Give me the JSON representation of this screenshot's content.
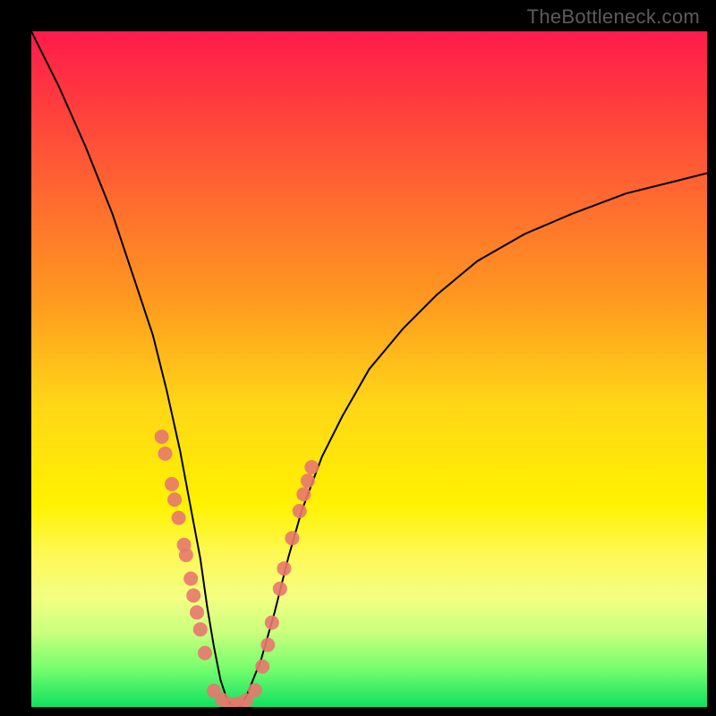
{
  "watermark": "TheBottleneck.com",
  "colors": {
    "dot": "#e8776e",
    "curve": "#000000",
    "frame": "#000000"
  },
  "chart_data": {
    "type": "line",
    "title": "",
    "xlabel": "",
    "ylabel": "",
    "xlim": [
      0,
      100
    ],
    "ylim": [
      0,
      100
    ],
    "series": [
      {
        "name": "bottleneck-curve",
        "x": [
          0,
          4,
          8,
          12,
          15,
          18,
          20,
          22,
          23.5,
          25,
          26,
          27,
          28,
          29,
          30,
          31,
          32,
          34,
          36,
          38,
          40,
          43,
          46,
          50,
          55,
          60,
          66,
          73,
          80,
          88,
          96,
          100
        ],
        "y": [
          100,
          92,
          83,
          73,
          64,
          55,
          47,
          38,
          30,
          22,
          15,
          9,
          4,
          1,
          0,
          0,
          2,
          7,
          14,
          22,
          29,
          37,
          43,
          50,
          56,
          61,
          66,
          70,
          73,
          76,
          78,
          79
        ]
      }
    ],
    "points": [
      {
        "name": "left-branch-dots",
        "coords": [
          {
            "x": 19.3,
            "y": 40.0
          },
          {
            "x": 19.8,
            "y": 37.5
          },
          {
            "x": 20.8,
            "y": 33.0
          },
          {
            "x": 21.2,
            "y": 30.7
          },
          {
            "x": 21.8,
            "y": 28.0
          },
          {
            "x": 22.6,
            "y": 24.0
          },
          {
            "x": 22.9,
            "y": 22.5
          },
          {
            "x": 23.6,
            "y": 19.0
          },
          {
            "x": 24.0,
            "y": 16.5
          },
          {
            "x": 24.5,
            "y": 14.0
          },
          {
            "x": 25.0,
            "y": 11.5
          },
          {
            "x": 25.7,
            "y": 8.0
          }
        ]
      },
      {
        "name": "valley-dots",
        "coords": [
          {
            "x": 27.0,
            "y": 2.4
          },
          {
            "x": 28.2,
            "y": 1.1
          },
          {
            "x": 29.4,
            "y": 0.4
          },
          {
            "x": 30.6,
            "y": 0.5
          },
          {
            "x": 31.8,
            "y": 1.0
          },
          {
            "x": 33.1,
            "y": 2.5
          }
        ]
      },
      {
        "name": "right-branch-dots",
        "coords": [
          {
            "x": 34.2,
            "y": 6.0
          },
          {
            "x": 35.0,
            "y": 9.2
          },
          {
            "x": 35.6,
            "y": 12.5
          },
          {
            "x": 36.8,
            "y": 17.5
          },
          {
            "x": 37.4,
            "y": 20.5
          },
          {
            "x": 38.6,
            "y": 25.0
          },
          {
            "x": 39.7,
            "y": 29.0
          },
          {
            "x": 40.3,
            "y": 31.5
          },
          {
            "x": 40.9,
            "y": 33.5
          },
          {
            "x": 41.5,
            "y": 35.5
          }
        ]
      }
    ]
  }
}
